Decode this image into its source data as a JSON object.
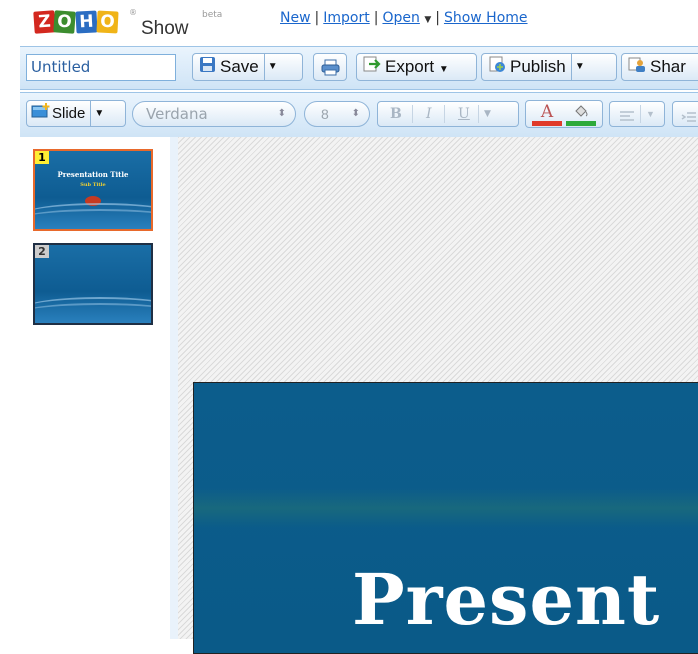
{
  "app": {
    "logo_letters": [
      "Z",
      "O",
      "H",
      "O"
    ],
    "logo_word": "Show",
    "logo_reg": "®",
    "beta_label": "beta"
  },
  "top_links": {
    "new": "New",
    "import": "Import",
    "open": "Open",
    "show_home": "Show Home"
  },
  "toolbar1": {
    "title_value": "Untitled",
    "save": "Save",
    "export": "Export",
    "publish": "Publish",
    "share": "Shar"
  },
  "toolbar2": {
    "slide": "Slide",
    "font_family": "Verdana",
    "font_size": "8",
    "bold": "B",
    "italic": "I",
    "underline": "U",
    "font_color_glyph": "A"
  },
  "slides": [
    {
      "number": "1",
      "title": "Presentation Title",
      "subtitle": "Sub Title",
      "selected": true
    },
    {
      "number": "2",
      "title": "",
      "subtitle": "",
      "selected": false
    }
  ],
  "canvas": {
    "slide_title": "Present"
  },
  "colors": {
    "toolbar_bg": "#dbe9f6",
    "slide_bg": "#0c5d8c",
    "link": "#1a66cc",
    "selected_thumb_border": "#e8692b"
  }
}
